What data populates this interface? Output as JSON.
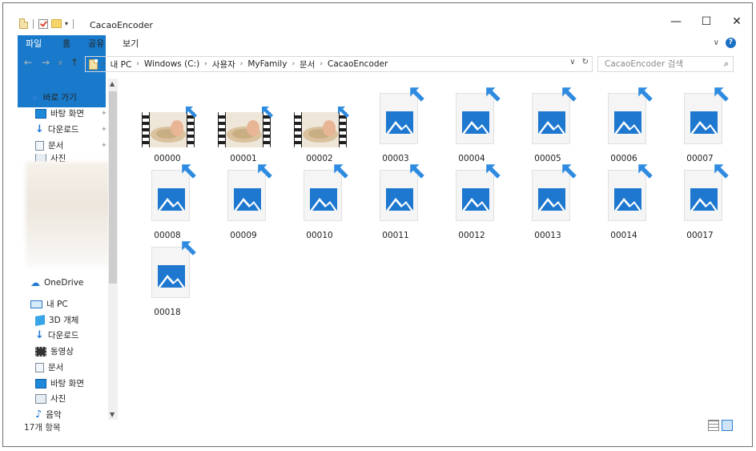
{
  "window": {
    "title": "CacaoEncoder",
    "minimize": "—",
    "maximize": "☐",
    "close": "✕"
  },
  "ribbon": {
    "tabs": [
      "파일",
      "홈",
      "공유",
      "보기"
    ],
    "expand": "∨",
    "help": "?"
  },
  "nav": {
    "back": "←",
    "forward": "→",
    "up": "↑",
    "breadcrumb": [
      "내 PC",
      "Windows (C:)",
      "사용자",
      "MyFamily",
      "문서",
      "CacaoEncoder"
    ],
    "dropdown": "∨",
    "refresh": "↻",
    "search_placeholder": "CacaoEncoder 검색"
  },
  "sidebar": {
    "quick_access": "바로 가기",
    "quick_items": [
      "바탕 화면",
      "다운로드",
      "문서",
      "사진"
    ],
    "onedrive": "OneDrive",
    "this_pc": "내 PC",
    "pc_items": [
      "3D 개체",
      "다운로드",
      "동영상",
      "문서",
      "바탕 화면",
      "사진",
      "음악"
    ]
  },
  "files": [
    {
      "name": "00000",
      "type": "video"
    },
    {
      "name": "00001",
      "type": "video"
    },
    {
      "name": "00002",
      "type": "video"
    },
    {
      "name": "00003",
      "type": "image"
    },
    {
      "name": "00004",
      "type": "image"
    },
    {
      "name": "00005",
      "type": "image"
    },
    {
      "name": "00006",
      "type": "image"
    },
    {
      "name": "00007",
      "type": "image"
    },
    {
      "name": "00008",
      "type": "image"
    },
    {
      "name": "00009",
      "type": "image"
    },
    {
      "name": "00010",
      "type": "image"
    },
    {
      "name": "00011",
      "type": "image"
    },
    {
      "name": "00012",
      "type": "image"
    },
    {
      "name": "00013",
      "type": "image"
    },
    {
      "name": "00014",
      "type": "image"
    },
    {
      "name": "00017",
      "type": "image"
    },
    {
      "name": "00018",
      "type": "image"
    }
  ],
  "status": {
    "count": "17개 항목"
  },
  "colors": {
    "accent": "#1979ca",
    "icon_blue": "#1e78d0"
  }
}
